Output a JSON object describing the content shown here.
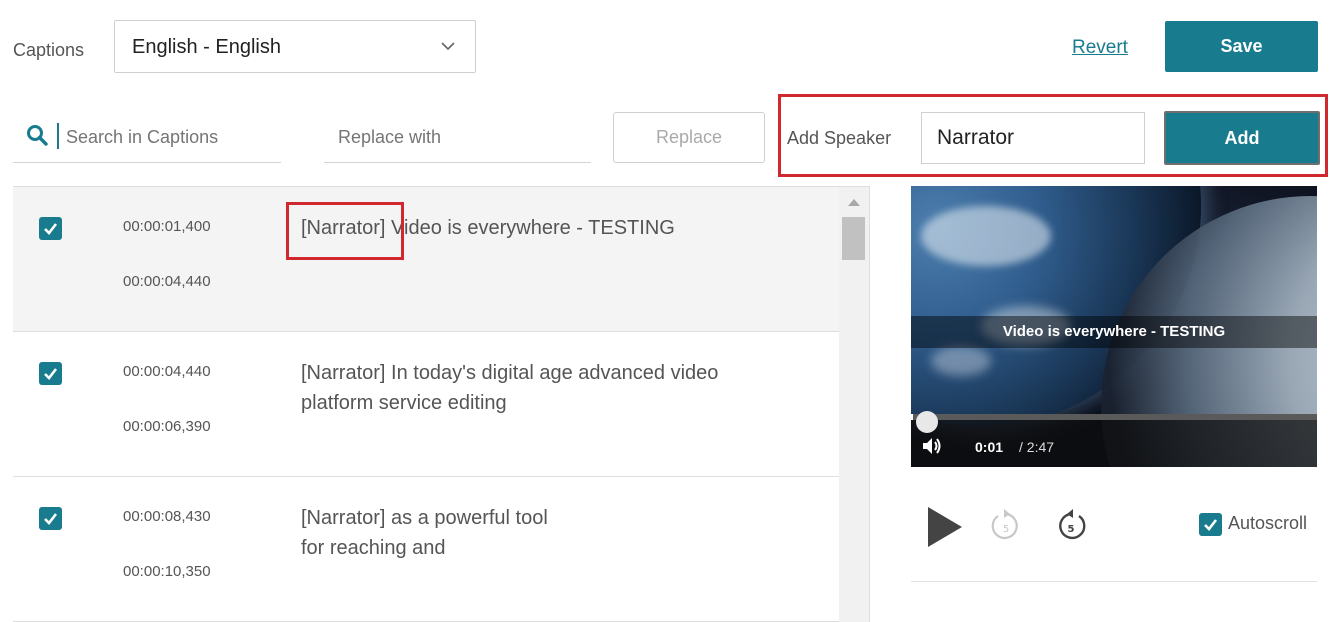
{
  "header": {
    "captions_label": "Captions",
    "language_selected": "English - English",
    "revert_label": "Revert",
    "save_label": "Save"
  },
  "search": {
    "search_placeholder": "Search in Captions",
    "replace_placeholder": "Replace with",
    "replace_label": "Replace"
  },
  "speaker": {
    "label": "Add Speaker",
    "value": "Narrator",
    "add_label": "Add"
  },
  "captions": [
    {
      "start": "00:00:01,400",
      "end": "00:00:04,440",
      "lines": [
        "[Narrator] Video is everywhere - TESTING"
      ],
      "checked": true
    },
    {
      "start": "00:00:04,440",
      "end": "00:00:06,390",
      "lines": [
        "[Narrator] In today's digital age advanced video",
        "platform service editing"
      ],
      "checked": true
    },
    {
      "start": "00:00:08,430",
      "end": "00:00:10,350",
      "lines": [
        "[Narrator] as a powerful tool",
        "for reaching and"
      ],
      "checked": true
    }
  ],
  "player": {
    "subtitle": "Video is everywhere - TESTING",
    "current_time": "0:01",
    "total_time": "/ 2:47",
    "progress_fraction": 0.006,
    "skip_seconds": "5",
    "autoscroll_label": "Autoscroll",
    "autoscroll_checked": true
  },
  "colors": {
    "accent": "#187c8e",
    "highlight": "#d0282e"
  },
  "icons": {
    "search": "search-icon",
    "dropdown": "chevron-down-icon",
    "check": "check-icon",
    "volume": "volume-icon",
    "play": "play-icon",
    "rewind": "rewind-5-icon",
    "forward": "forward-5-icon"
  }
}
